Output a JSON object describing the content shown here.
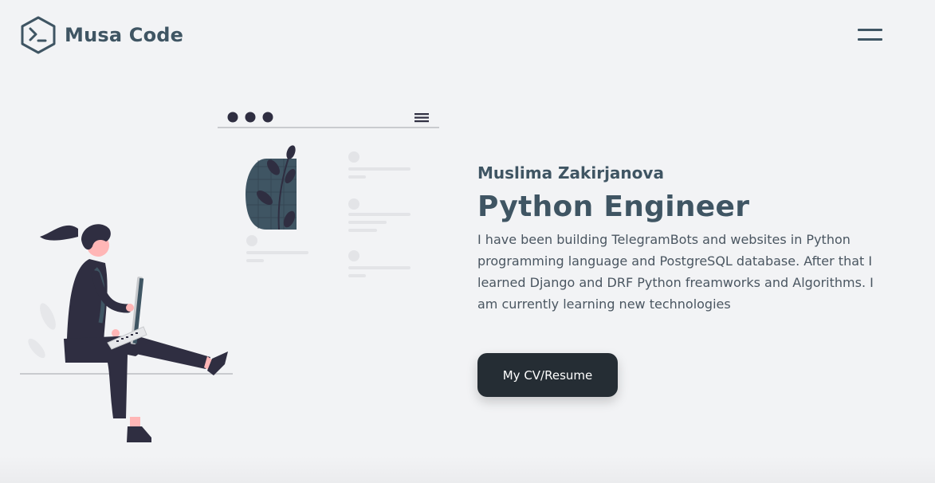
{
  "header": {
    "logo_text": "Musa Code",
    "logo_icon": "terminal-hexagon-icon",
    "menu_icon": "hamburger-menu-icon"
  },
  "hero": {
    "name": "Muslima Zakirjanova",
    "role": "Python Engineer",
    "description": "I have been building TelegramBots and websites in Python programming language and PostgreSQL database. After that I learned Django and DRF Python freamworks and Algorithms. I am currently learning new technologies",
    "cv_button_label": "My CV/Resume"
  },
  "colors": {
    "background": "#f2f3f5",
    "heading": "#3f5563",
    "button": "#252d34",
    "accent_dark": "#2f2e41",
    "skin": "#ffb6b6"
  }
}
